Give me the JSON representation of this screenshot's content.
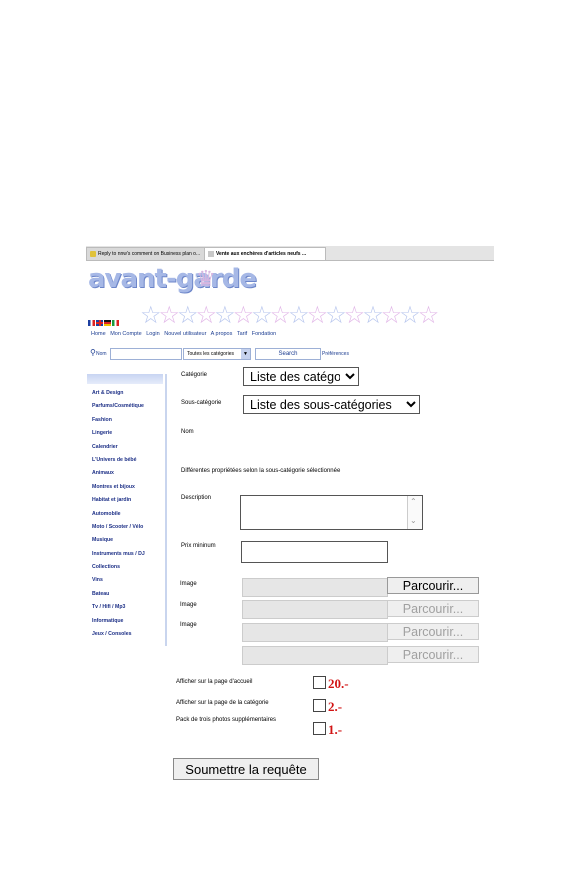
{
  "browser": {
    "tab1": "Reply to nnw's comment on Business plan o...",
    "tab2": "Vente aux enchères d'articles neufs ..."
  },
  "site": {
    "logo": "avant-garde",
    "nav": [
      "Home",
      "Mon Compte",
      "Login",
      "Nouvel utilisateur",
      "A propos",
      "Tarif",
      "Fondation"
    ]
  },
  "search": {
    "label": "Nom",
    "category_select": "Toutes les catégories",
    "button": "Search",
    "preferences": "Préférences"
  },
  "sidebar": {
    "items": [
      "Art & Design",
      "Parfums/Cosmétique",
      "Fashion",
      "Lingerie",
      "Calendrier",
      "L'Univers de bébé",
      "Animaux",
      "Montres et bijoux",
      "Habitat et jardin",
      "Automobile",
      "Moto / Scooter / Vélo",
      "Musique",
      "Instruments mus / DJ",
      "Collections",
      "Vins",
      "Bateau",
      "Tv / Hifi / Mp3",
      "Informatique",
      "Jeux / Consoles"
    ]
  },
  "form": {
    "categorie_label": "Catégorie",
    "categorie_value": "Liste des catégories",
    "souscategorie_label": "Sous-catégorie",
    "souscategorie_value": "Liste des sous-catégories",
    "nom_label": "Nom",
    "proprietes_text": "Différentes propriétées selon la sous-catégorie sélectionnée",
    "description_label": "Description",
    "prix_label": "Prix mininum",
    "image_label": "Image",
    "browse_label": "Parcourir...",
    "accueil_label": "Afficher sur la page d'accueil",
    "accueil_price": "20.-",
    "categorie_page_label": "Afficher sur la page de la catégorie",
    "categorie_page_price": "2.-",
    "photos_label": "Pack de trois photos supplémentaires",
    "photos_price": "1.-",
    "submit": "Soumettre la requête"
  },
  "colors": {
    "accent": "#1c3d91",
    "price": "#d21414",
    "logo": "#a6b8e6"
  }
}
